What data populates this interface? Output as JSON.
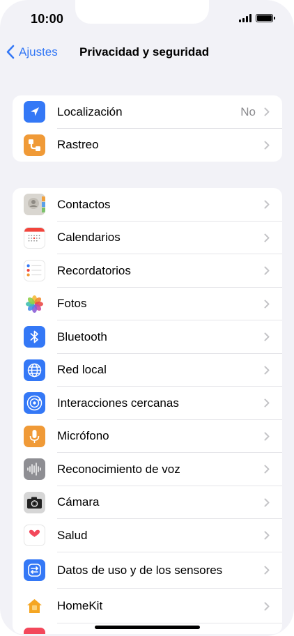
{
  "status": {
    "time": "10:00"
  },
  "nav": {
    "back_label": "Ajustes",
    "title": "Privacidad y seguridad"
  },
  "group1": [
    {
      "label": "Localización",
      "value": "No",
      "icon": "location-arrow-icon",
      "color": "#3478f6"
    },
    {
      "label": "Rastreo",
      "value": "",
      "icon": "tracking-icon",
      "color": "#f09a37"
    }
  ],
  "group2": [
    {
      "label": "Contactos",
      "icon": "contacts-icon"
    },
    {
      "label": "Calendarios",
      "icon": "calendar-icon"
    },
    {
      "label": "Recordatorios",
      "icon": "reminders-icon"
    },
    {
      "label": "Fotos",
      "icon": "photos-icon"
    },
    {
      "label": "Bluetooth",
      "icon": "bluetooth-icon"
    },
    {
      "label": "Red local",
      "icon": "globe-icon"
    },
    {
      "label": "Interacciones cercanas",
      "icon": "nearby-interaction-icon"
    },
    {
      "label": "Micrófono",
      "icon": "microphone-icon"
    },
    {
      "label": "Reconocimiento de voz",
      "icon": "waveform-icon"
    },
    {
      "label": "Cámara",
      "icon": "camera-icon"
    },
    {
      "label": "Salud",
      "icon": "heart-icon"
    },
    {
      "label": "Datos de uso y de los sensores",
      "icon": "sensor-data-icon"
    },
    {
      "label": "HomeKit",
      "icon": "home-icon"
    }
  ],
  "colors": {
    "accent": "#3478f6",
    "background": "#f2f2f7"
  }
}
